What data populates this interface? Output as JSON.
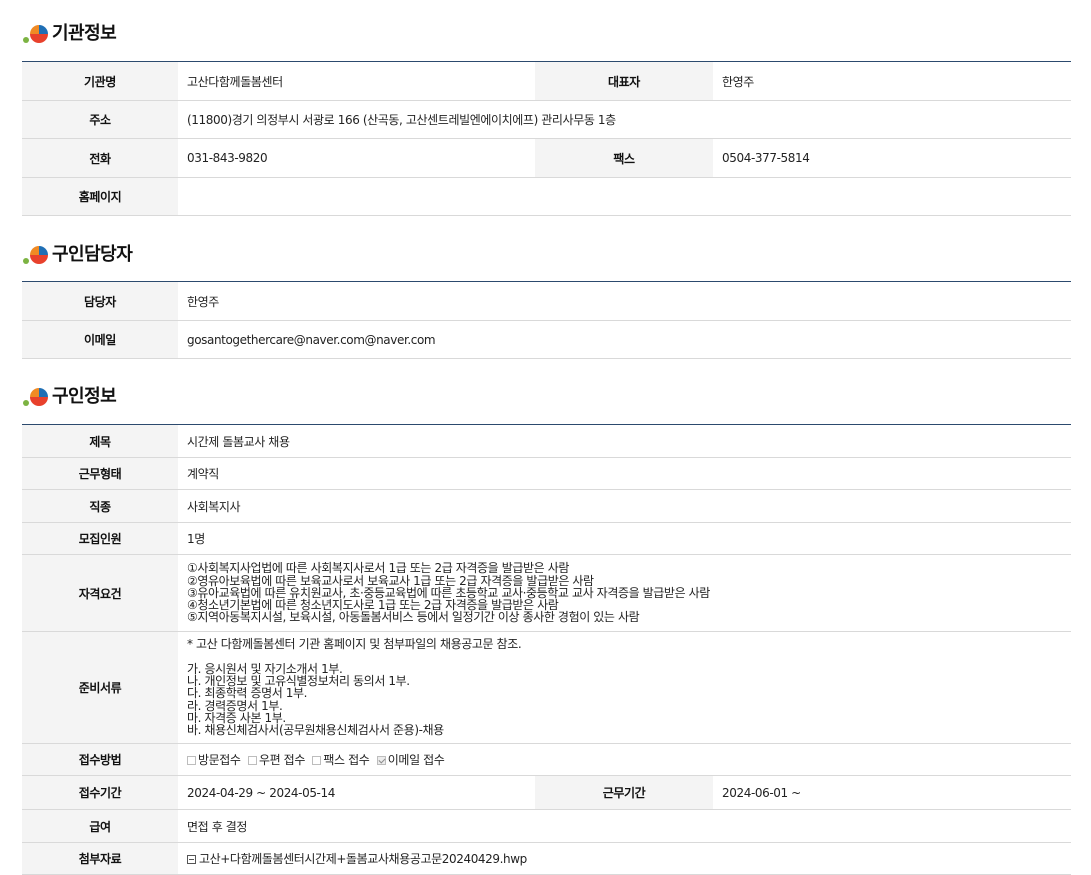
{
  "org_section": {
    "title": "기관정보",
    "name_label": "기관명",
    "name": "고산다함께돌봄센터",
    "ceo_label": "대표자",
    "ceo": "한영주",
    "address_label": "주소",
    "address": "(11800)경기 의정부시 서광로 166 (산곡동, 고산센트레빌엔에이치에프) 관리사무동 1층",
    "phone_label": "전화",
    "phone": "031-843-9820",
    "fax_label": "팩스",
    "fax": "0504-377-5814",
    "homepage_label": "홈페이지",
    "homepage": ""
  },
  "contact_section": {
    "title": "구인담당자",
    "manager_label": "담당자",
    "manager": "한영주",
    "email_label": "이메일",
    "email": "gosantogethercare@naver.com@naver.com"
  },
  "job_section": {
    "title": "구인정보",
    "subject_label": "제목",
    "subject": "시간제 돌봄교사 채용",
    "work_type_label": "근무형태",
    "work_type": "계약직",
    "occupation_label": "직종",
    "occupation": "사회복지사",
    "headcount_label": "모집인원",
    "headcount": "1명",
    "qualification_label": "자격요건",
    "qualifications": [
      "①사회복지사업법에 따른 사회복지사로서 1급 또는 2급 자격증을 발급받은 사람",
      "②영유아보육법에 따른 보육교사로서 보육교사 1급 또는 2급 자격증을 발급받은 사람",
      "③유아교육법에 따른 유치원교사, 초·중등교육법에 따른 초등학교 교사·중등학교 교사 자격증을 발급받은 사람",
      "④청소년기본법에 따른 청소년지도사로 1급 또는 2급 자격증을 발급받은 사람",
      "⑤지역아동복지시설, 보육시설, 아동돌봄서비스 등에서 일정기간 이상 종사한 경험이 있는 사람"
    ],
    "documents_label": "준비서류",
    "documents_note": "* 고산 다함께돌봄센터 기관 홈페이지 및 첨부파일의 채용공고문 참조.",
    "documents": [
      "가. 응시원서 및 자기소개서 1부.",
      "나. 개인정보 및 고유식별정보처리 동의서 1부.",
      "다. 최종학력 증명서 1부.",
      "라. 경력증명서 1부.",
      "마. 자격증 사본 1부.",
      "바. 채용신체검사서(공무원채용신체검사서 준용)-채용"
    ],
    "apply_method_label": "접수방법",
    "apply_methods": [
      {
        "label": "방문접수",
        "checked": false
      },
      {
        "label": "우편 접수",
        "checked": false
      },
      {
        "label": "팩스 접수",
        "checked": false
      },
      {
        "label": "이메일 접수",
        "checked": true
      }
    ],
    "apply_period_label": "접수기간",
    "apply_period": "2024-04-29 ~ 2024-05-14",
    "work_period_label": "근무기간",
    "work_period": "2024-06-01 ~",
    "salary_label": "급여",
    "salary": "면접 후 결정",
    "attachment_label": "첨부자료",
    "attachment": "고산+다함께돌봄센터시간제+돌봄교사채용공고문20240429.hwp"
  },
  "colors": {
    "table_top_border": "#2c4a6e",
    "header_cell_bg": "#f4f4f4",
    "row_border": "#d9d9d9",
    "icon_orange": "#f08a24",
    "icon_blue": "#1f6fb5",
    "icon_red": "#e8412c",
    "icon_green": "#7cb342"
  }
}
